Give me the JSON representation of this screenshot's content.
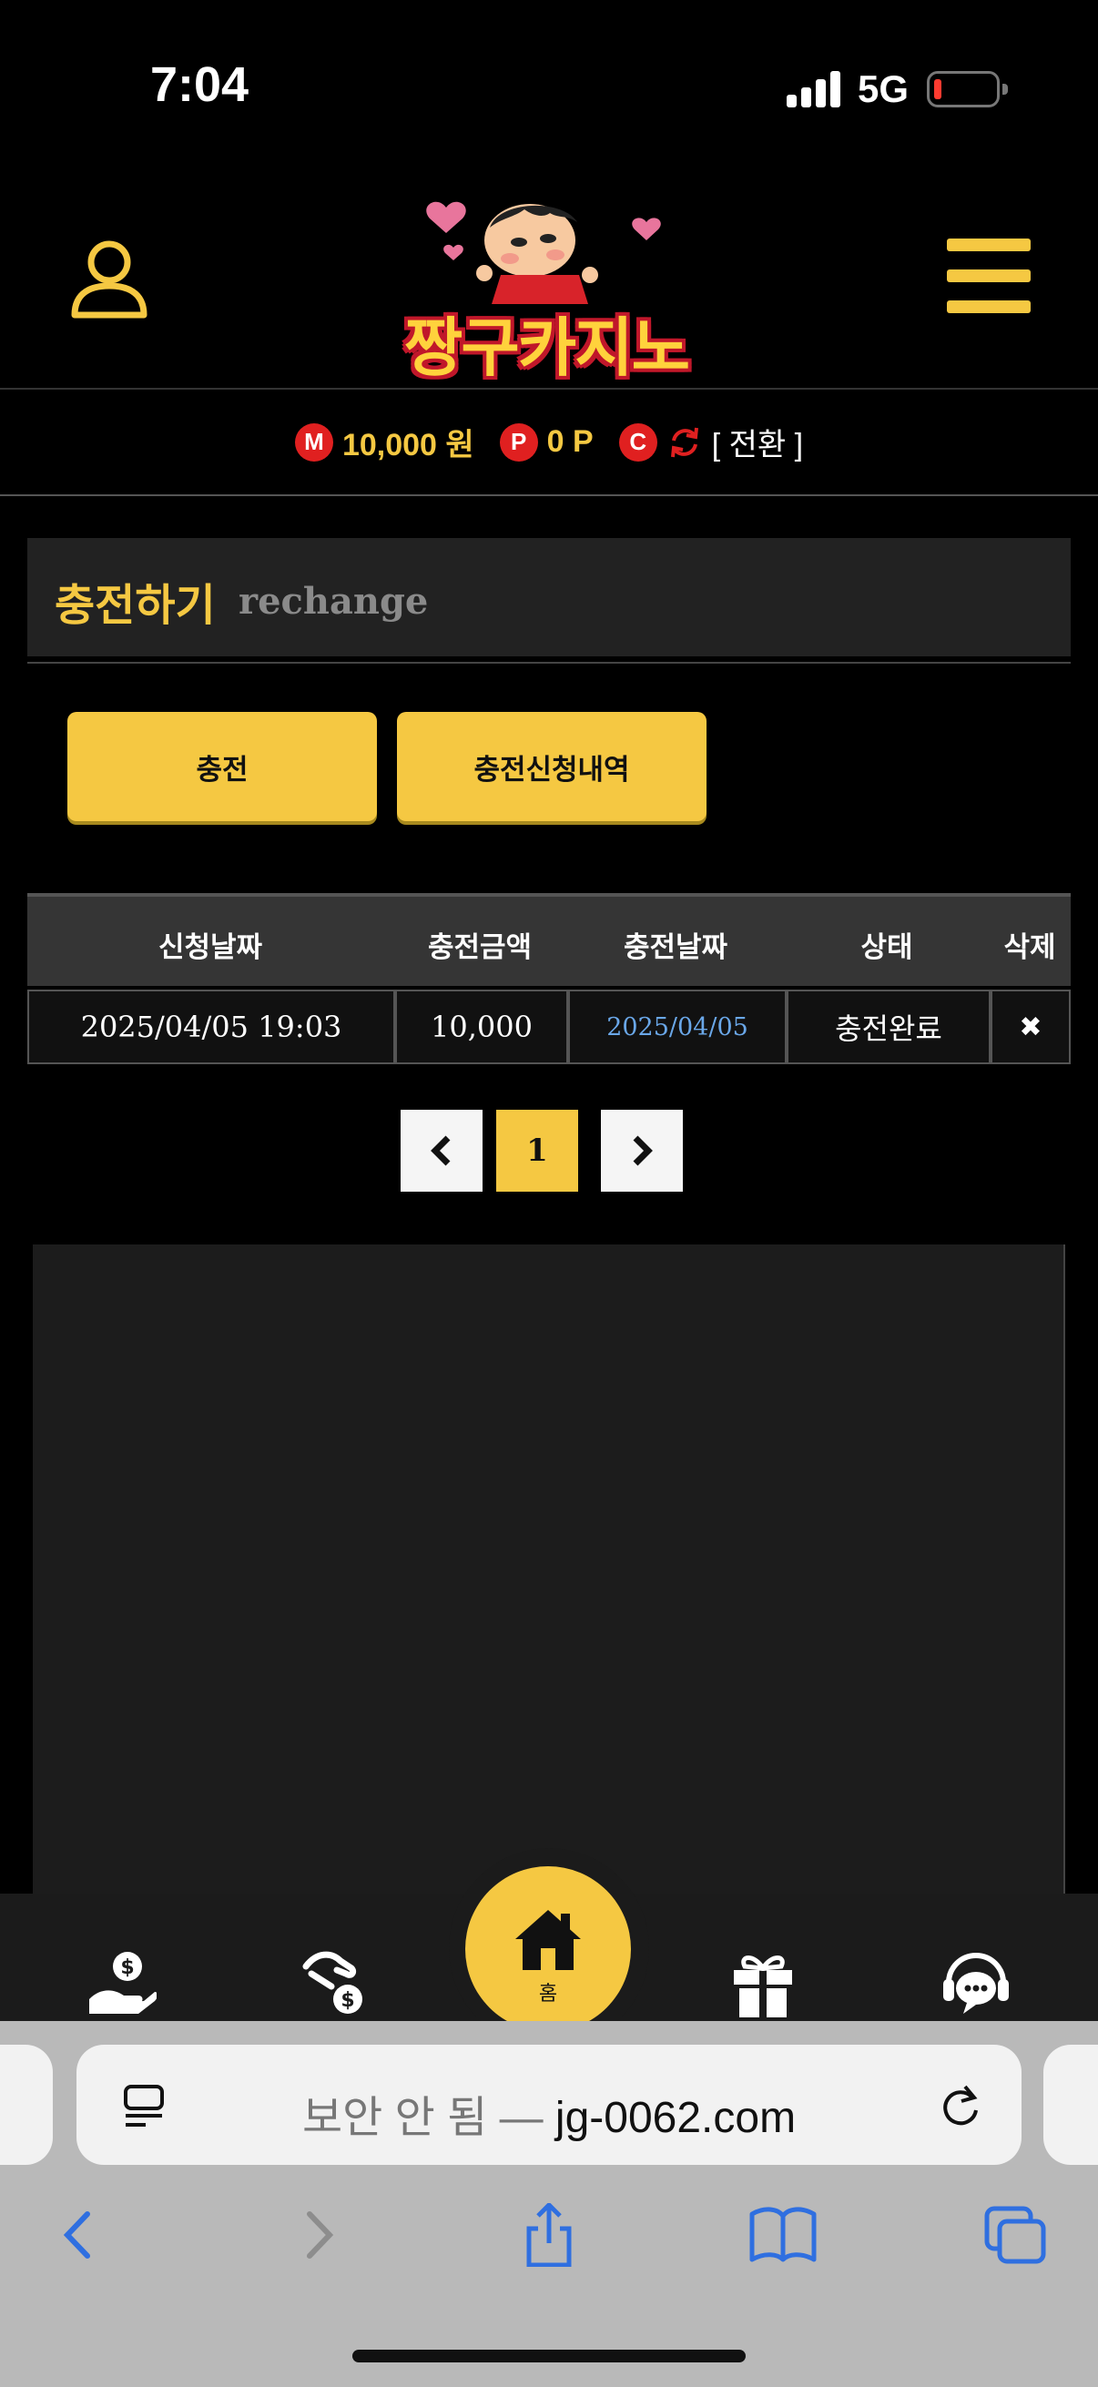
{
  "status_bar": {
    "time": "7:04",
    "network": "5G"
  },
  "header": {
    "logo_text": "짱구카지노"
  },
  "balance": {
    "money_badge": "M",
    "money_value": "10,000 원",
    "point_badge": "P",
    "point_value": "0 P",
    "coin_badge": "C",
    "switch_label": "[ 전환 ]"
  },
  "section": {
    "title_ko": "충전하기",
    "title_en": "rechange"
  },
  "buttons": {
    "charge": "충전",
    "history": "충전신청내역"
  },
  "table": {
    "headers": [
      "신청날짜",
      "충전금액",
      "충전날짜",
      "상태",
      "삭제"
    ],
    "rows": [
      {
        "request_date": "2025/04/05 19:03",
        "amount": "10,000",
        "charge_date": "2025/04/05",
        "status": "충전완료",
        "delete": "✖"
      }
    ]
  },
  "pagination": {
    "current": "1"
  },
  "bottom_nav": {
    "home_label": "홈"
  },
  "browser": {
    "url_prefix": "보안 안 됨 — ",
    "url_domain": "jg-0062.com"
  },
  "colors": {
    "accent": "#f5c842",
    "badge_red": "#e02020",
    "date_link": "#6aa7e8"
  }
}
